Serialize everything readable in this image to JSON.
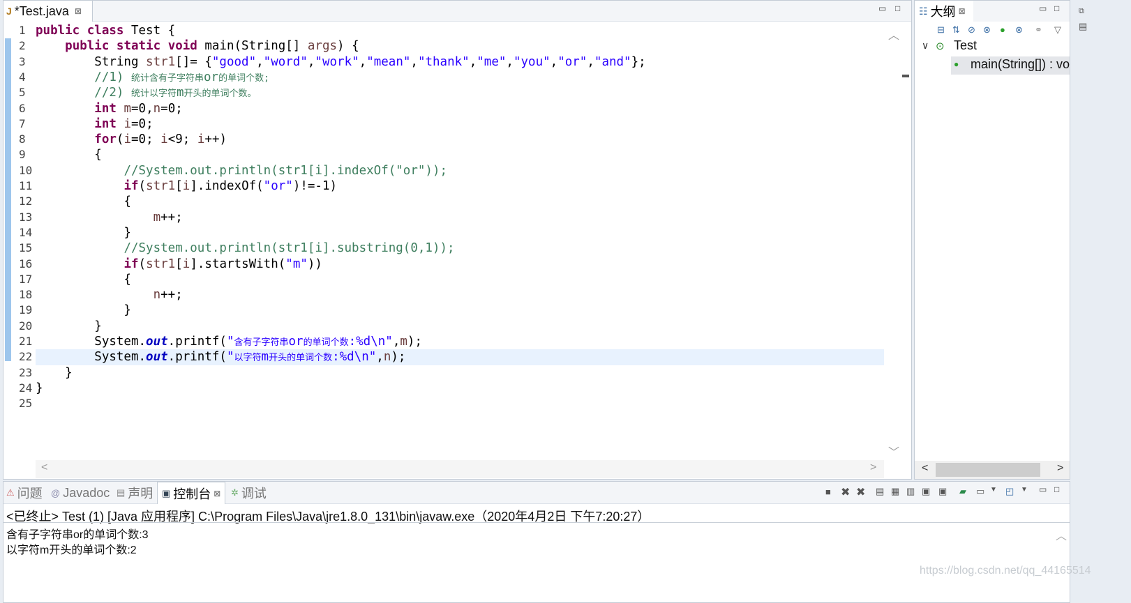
{
  "editor": {
    "tab_label": "*Test.java",
    "tab_close": "⊠",
    "line_numbers": [
      "1",
      "2",
      "3",
      "4",
      "5",
      "6",
      "7",
      "8",
      "9",
      "10",
      "11",
      "12",
      "13",
      "14",
      "15",
      "16",
      "17",
      "18",
      "19",
      "20",
      "21",
      "22",
      "23",
      "24",
      "25"
    ],
    "highlighted_line": 22
  },
  "outline": {
    "tab_label": "大纲",
    "tab_close": "⊠",
    "tree_root": "Test",
    "tree_child": "main(String[]) : vo"
  },
  "console": {
    "tabs": [
      {
        "label": "问题",
        "icon": "problems-icon"
      },
      {
        "label": "Javadoc",
        "icon": "javadoc-icon"
      },
      {
        "label": "声明",
        "icon": "declaration-icon"
      },
      {
        "label": "控制台",
        "icon": "console-icon"
      },
      {
        "label": "调试",
        "icon": "debug-icon"
      }
    ],
    "active_tab": "控制台",
    "title": "<已终止> Test (1) [Java 应用程序] C:\\Program Files\\Java\\jre1.8.0_131\\bin\\javaw.exe（2020年4月2日 下午7:20:27）",
    "output": [
      "含有子字符串or的单词个数:3",
      "以字符m开头的单词个数:2"
    ]
  },
  "watermark": "https://blog.csdn.net/qq_44165514",
  "colors": {
    "keyword": "#7f0055",
    "string": "#2a00ff",
    "comment": "#3f7f5f",
    "field": "#0000c0",
    "change_bar": "#9ec6ec",
    "current_line": "#e8f2fe"
  }
}
